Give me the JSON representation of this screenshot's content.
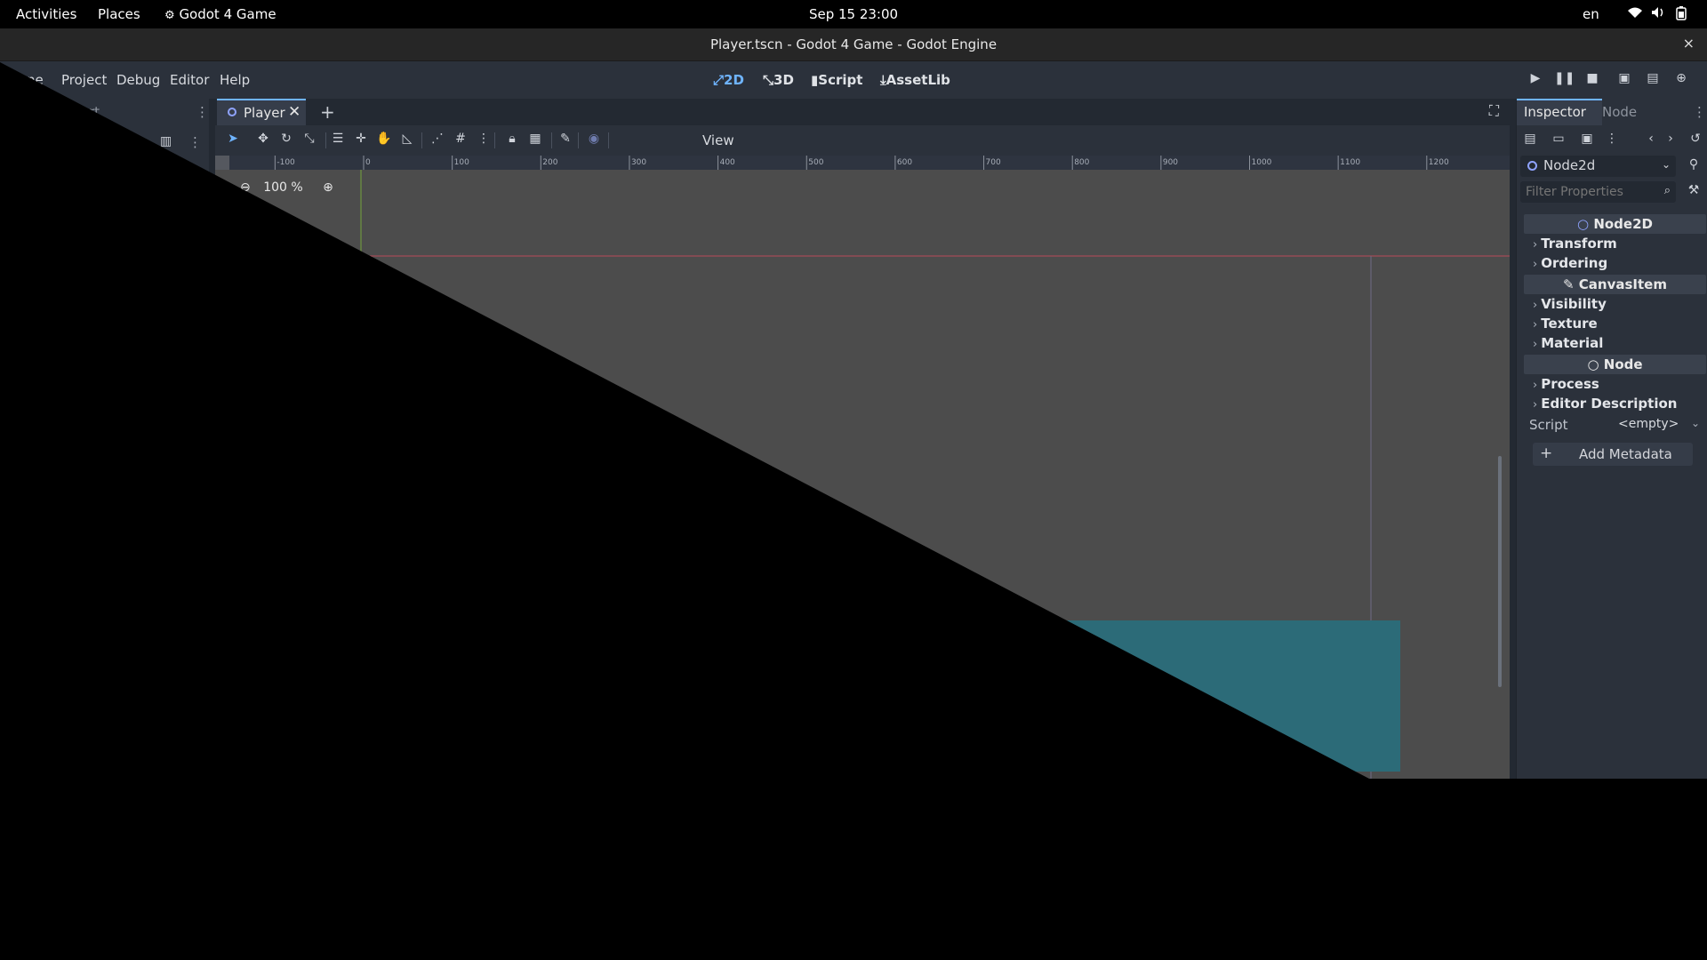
{
  "system_bar": {
    "activities": "Activities",
    "places": "Places",
    "app": "Godot 4 Game",
    "clock": "Sep 15  23:00",
    "language": "en"
  },
  "window": {
    "title": "Player.tscn - Godot 4 Game - Godot Engine",
    "close": "×"
  },
  "menubar": {
    "items": [
      "ne",
      "Project",
      "Debug",
      "Editor",
      "Help"
    ],
    "workspaces": [
      {
        "label": "2D",
        "icon": "2d-icon",
        "active": true
      },
      {
        "label": "3D",
        "icon": "3d-icon"
      },
      {
        "label": "Script",
        "icon": "script-icon"
      },
      {
        "label": "AssetLib",
        "icon": "assetlib-icon"
      }
    ]
  },
  "left_dock": {
    "title_fragment": "rt"
  },
  "scene_tabs": {
    "active_tab": "Player"
  },
  "toolbar": {
    "view_label": "View"
  },
  "viewport": {
    "zoom": "100 %",
    "ruler_labels": [
      "-100",
      "0",
      "100",
      "200",
      "300",
      "400",
      "500",
      "600",
      "700",
      "800",
      "900",
      "1000",
      "1100",
      "1200"
    ]
  },
  "inspector": {
    "tab_inspector": "Inspector",
    "tab_node": "Node",
    "node_selector": "Node2d",
    "filter_placeholder": "Filter Properties",
    "sections": {
      "node2d": "Node2D",
      "canvasitem": "CanvasItem",
      "node": "Node"
    },
    "properties": {
      "transform": "Transform",
      "ordering": "Ordering",
      "visibility": "Visibility",
      "texture": "Texture",
      "material": "Material",
      "process": "Process",
      "editor_description": "Editor Description"
    },
    "script_label": "Script",
    "script_value": "<empty>",
    "add_metadata": "Add Metadata"
  },
  "colors": {
    "accent": "#6fb4ff",
    "teal_rect": "#2c6b78",
    "viewport_bg": "#4c4c4c"
  }
}
